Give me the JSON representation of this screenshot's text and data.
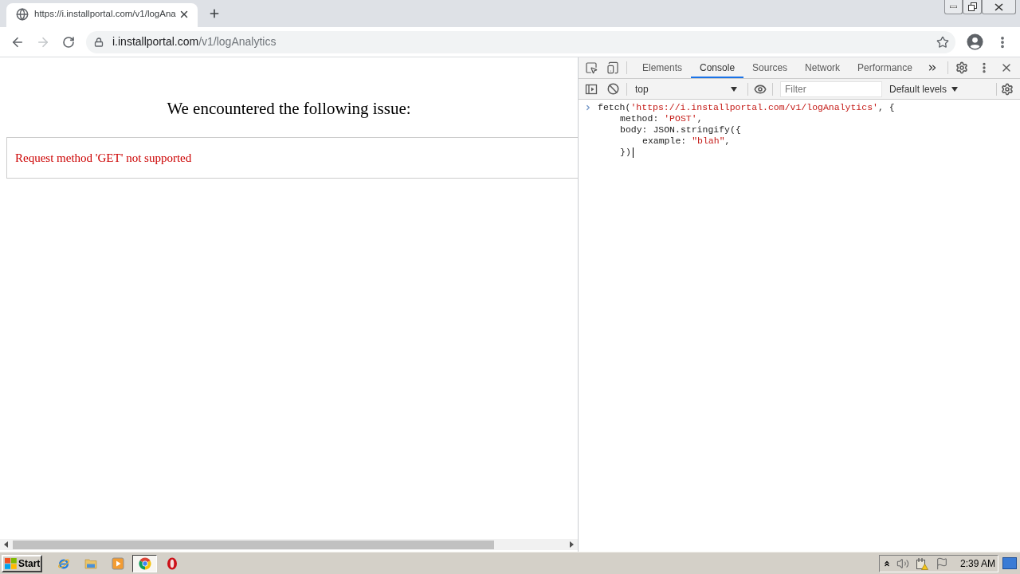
{
  "browser": {
    "tabs": [
      {
        "title": "https://i.installportal.com/v1/logAna",
        "selected": true
      }
    ],
    "window_buttons": [
      {
        "kind": "minimize"
      },
      {
        "kind": "restore"
      },
      {
        "kind": "close"
      }
    ],
    "nav_buttons": [
      {
        "kind": "back",
        "disabled": false
      },
      {
        "kind": "forward",
        "disabled": true
      },
      {
        "kind": "reload",
        "disabled": false
      }
    ],
    "address": {
      "host": "i.installportal.com",
      "path": "/v1/logAnalytics"
    }
  },
  "page": {
    "heading": "We encountered the following issue:",
    "error": "Request method 'GET' not supported"
  },
  "devtools": {
    "tabs": [
      {
        "label": "Elements",
        "selected": false
      },
      {
        "label": "Console",
        "selected": true
      },
      {
        "label": "Sources",
        "selected": false
      },
      {
        "label": "Network",
        "selected": false
      },
      {
        "label": "Performance",
        "selected": false
      }
    ],
    "context": "top",
    "filter": {
      "placeholder": "Filter"
    },
    "levels": "Default levels",
    "console": [
      {
        "tokens": [
          {
            "kind": "plain",
            "text": "fetch("
          },
          {
            "kind": "string",
            "text": "'https://i.installportal.com/v1/logAnalytics'"
          },
          {
            "kind": "plain",
            "text": ", {"
          }
        ],
        "children": [
          {
            "tokens": [
              {
                "kind": "plain",
                "text": "method: "
              },
              {
                "kind": "string",
                "text": "'POST'"
              },
              {
                "kind": "plain",
                "text": ","
              }
            ]
          },
          {
            "tokens": [
              {
                "kind": "plain",
                "text": "body: JSON.stringify({"
              }
            ],
            "children": [
              {
                "tokens": [
                  {
                    "kind": "plain",
                    "text": "example: "
                  },
                  {
                    "kind": "string",
                    "text": "\"blah\""
                  },
                  {
                    "kind": "plain",
                    "text": ","
                  }
                ]
              }
            ]
          },
          {
            "tokens": [
              {
                "kind": "plain",
                "text": "})"
              },
              {
                "kind": "caret"
              }
            ]
          }
        ]
      }
    ]
  },
  "taskbar": {
    "start": "Start",
    "apps": [
      {
        "kind": "ie",
        "selected": false
      },
      {
        "kind": "explorer",
        "selected": false
      },
      {
        "kind": "media",
        "selected": false
      },
      {
        "kind": "chrome",
        "selected": true
      },
      {
        "kind": "opera",
        "selected": false
      }
    ],
    "clock": "2:39 AM"
  }
}
